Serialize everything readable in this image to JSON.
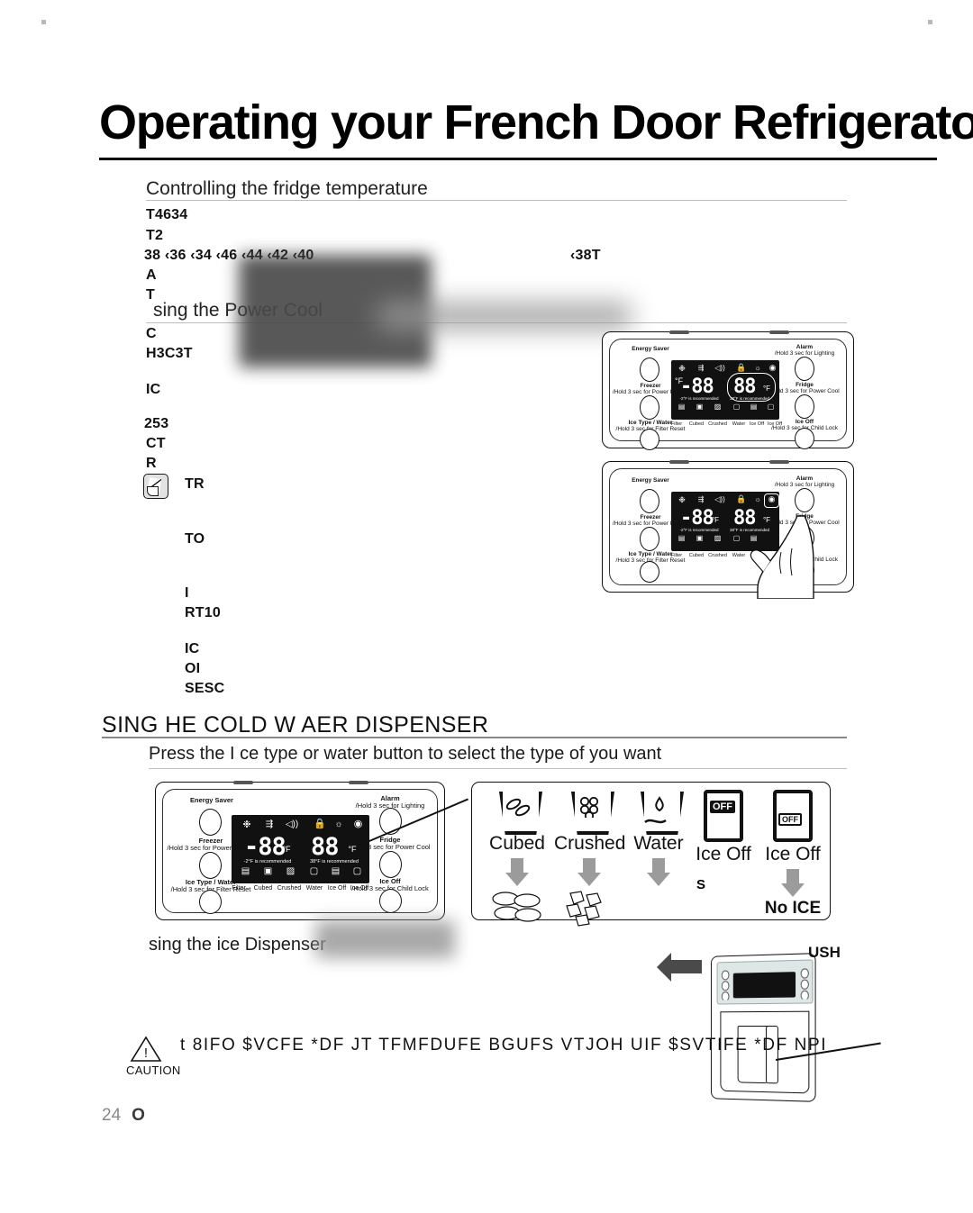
{
  "page": {
    "title": "Operating your French Door Refrigerato",
    "number": "24",
    "number_suffix": "O"
  },
  "sections": {
    "fridge_temp": {
      "heading": "Controlling the fridge temperature",
      "lines": [
        "T4634",
        "T2",
        "38 ‹36 ‹34 ‹46 ‹44 ‹42 ‹40",
        "A",
        "T"
      ],
      "right_value": "‹38T"
    },
    "power_cool": {
      "heading": "sing the Power Cool",
      "lines": [
        "C",
        "H3C3T",
        "IC",
        "253",
        "CT",
        "R"
      ],
      "note_label": "TR",
      "indented": [
        "TO",
        "I",
        "RT10",
        "IC",
        "OI",
        "SESC"
      ]
    },
    "cold_water": {
      "heading": "SING HE COLD W    AER DISPENSER",
      "subheading": "Press the I ce type or water button to select the type of you want"
    },
    "ice_dispenser": {
      "heading": "sing the ice Dispenser"
    }
  },
  "control_panel": {
    "left_buttons": [
      {
        "name": "Energy Saver",
        "sub": ""
      },
      {
        "name": "Freezer",
        "sub": "/Hold 3 sec for Power Freeze"
      },
      {
        "name": "Ice Type / Water",
        "sub": "/Hold 3 sec for Filter Reset"
      }
    ],
    "right_buttons": [
      {
        "name": "Alarm",
        "sub": "/Hold 3 sec for Lighting"
      },
      {
        "name": "Fridge",
        "sub": "/Hold 3 sec for Power Cool"
      },
      {
        "name": "Ice Off",
        "sub": "/Hold 3 sec for Child Lock"
      }
    ],
    "lcd": {
      "top_icons": [
        "snowflake-icon",
        "power-freeze-icon",
        "alarm-icon",
        "lock-icon",
        "lighting-icon",
        "power-cool-icon"
      ],
      "freezer_value": "-88",
      "freezer_unit": "°F",
      "freezer_recommend": "-2°F is recommended",
      "fridge_value": "88",
      "fridge_unit": "°F",
      "fridge_recommend": "38°F is recommended",
      "bottom_icons": [
        "filter-icon",
        "cubed-icon",
        "crushed-icon",
        "water-icon",
        "ice-off-icon",
        "ice-off-icon"
      ],
      "bottom_labels": [
        "Filter",
        "Cubed",
        "Crushed",
        "Water",
        "Ice Off",
        "Ice Off"
      ]
    }
  },
  "dispenser_options": [
    {
      "label": "Cubed",
      "icon": "glass-cubed-icon",
      "result": "cubed-ice-icon",
      "result_text": ""
    },
    {
      "label": "Crushed",
      "icon": "glass-crushed-icon",
      "result": "crushed-ice-icon",
      "result_text": ""
    },
    {
      "label": "Water",
      "icon": "glass-water-icon",
      "result": "",
      "result_text": ""
    },
    {
      "label": "Ice Off",
      "icon": "ice-off-solid-icon",
      "result": "",
      "result_text": "S"
    },
    {
      "label": "Ice Off",
      "icon": "ice-off-outline-icon",
      "result": "",
      "result_text": "No ICE"
    }
  ],
  "caution": {
    "word": "CAUTION",
    "text": "t 8IFO $VCFE *DF JT TFMFDUFE BGUFS VTJOH UIF $SVTIFE *DF NPI"
  },
  "fridge_figure": {
    "push_label": "USH"
  }
}
